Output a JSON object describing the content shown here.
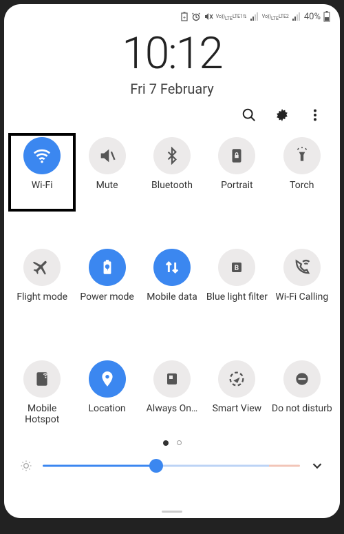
{
  "status_bar": {
    "battery_percent": "40%",
    "lte1": "LTE1",
    "lte2": "LTE2",
    "volte": "Vo))"
  },
  "clock": "10:12",
  "date": "Fri 7 February",
  "tiles": [
    {
      "label": "Wi-Fi",
      "active": true
    },
    {
      "label": "Mute",
      "active": false
    },
    {
      "label": "Bluetooth",
      "active": false
    },
    {
      "label": "Portrait",
      "active": false
    },
    {
      "label": "Torch",
      "active": false
    },
    {
      "label": "Flight mode",
      "active": false
    },
    {
      "label": "Power mode",
      "active": true
    },
    {
      "label": "Mobile data",
      "active": true
    },
    {
      "label": "Blue light filter",
      "active": false
    },
    {
      "label": "Wi-Fi Calling",
      "active": false
    },
    {
      "label": "Mobile Hotspot",
      "active": false
    },
    {
      "label": "Location",
      "active": true
    },
    {
      "label": "Always On…",
      "active": false
    },
    {
      "label": "Smart View",
      "active": false
    },
    {
      "label": "Do not disturb",
      "active": false
    }
  ],
  "brightness": {
    "value": 44
  },
  "pager": {
    "current": 0,
    "total": 2
  }
}
